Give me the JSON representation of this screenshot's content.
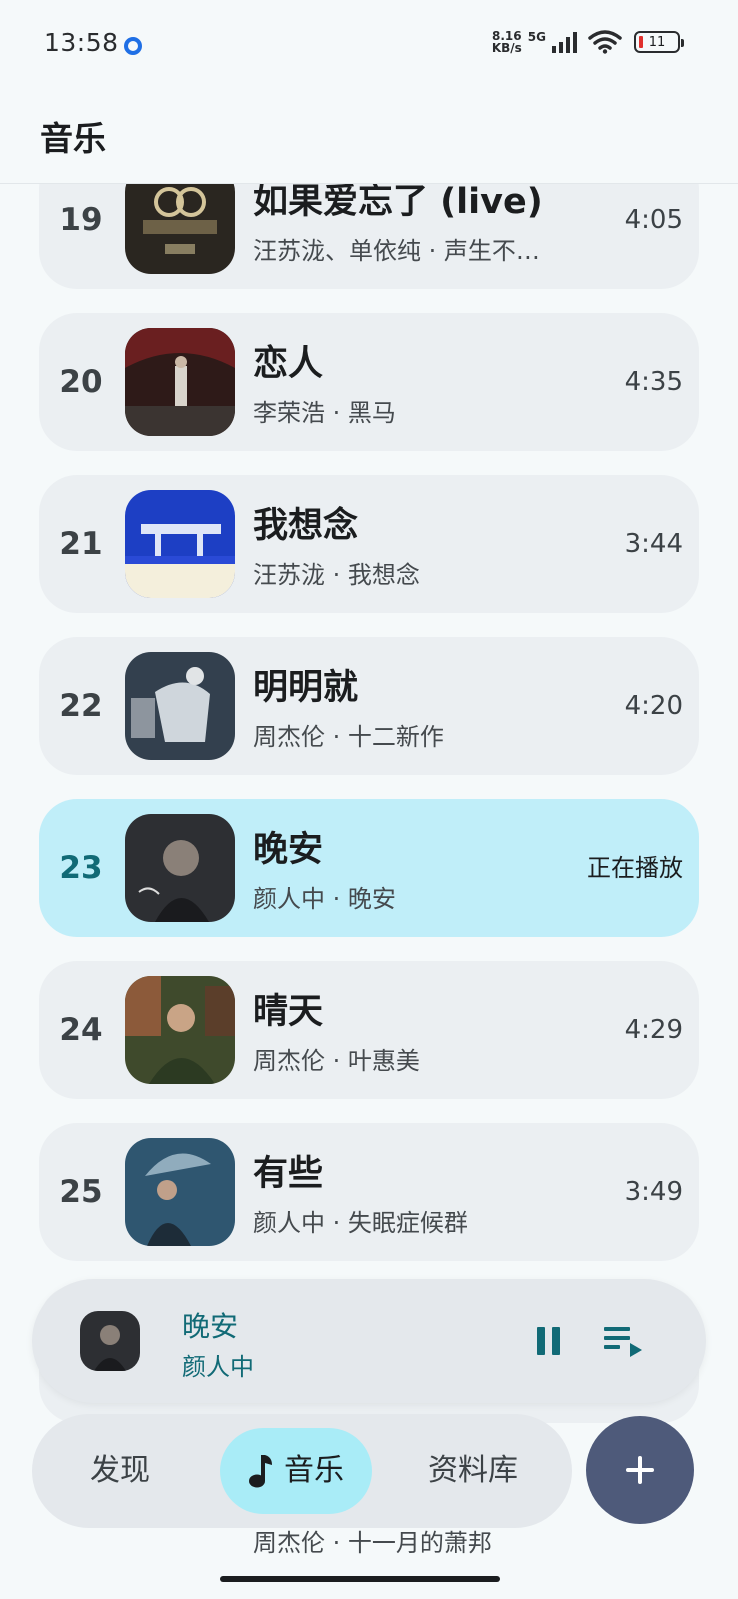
{
  "status_bar": {
    "time": "13:58",
    "net_speed_top": "8.16",
    "net_speed_bottom": "KB/s",
    "network": "5G",
    "battery": "11"
  },
  "header": {
    "title": "音乐"
  },
  "songs": [
    {
      "index": "19",
      "title": "如果爱忘了 (live)",
      "subtitle": "汪苏泷、单依纯 · 声生不…",
      "duration": "4:05"
    },
    {
      "index": "20",
      "title": "恋人",
      "subtitle": "李荣浩 · 黑马",
      "duration": "4:35"
    },
    {
      "index": "21",
      "title": "我想念",
      "subtitle": "汪苏泷 · 我想念",
      "duration": "3:44"
    },
    {
      "index": "22",
      "title": "明明就",
      "subtitle": "周杰伦 · 十二新作",
      "duration": "4:20"
    },
    {
      "index": "23",
      "title": "晚安",
      "subtitle": "颜人中 · 晚安",
      "duration": "正在播放"
    },
    {
      "index": "24",
      "title": "晴天",
      "subtitle": "周杰伦 · 叶惠美",
      "duration": "4:29"
    },
    {
      "index": "25",
      "title": "有些",
      "subtitle": "颜人中 · 失眠症候群",
      "duration": "3:49"
    }
  ],
  "partial_row": {
    "subtitle": "周杰伦 · 十一月的萧邦"
  },
  "mini_player": {
    "title": "晚安",
    "artist": "颜人中"
  },
  "bottom_nav": {
    "discover": "发现",
    "music": "音乐",
    "library": "资料库"
  },
  "icons": {
    "status_dot": "location-dot-icon",
    "signal": "signal-icon",
    "wifi": "wifi-icon",
    "battery": "battery-icon",
    "pause": "pause-icon",
    "queue": "queue-icon",
    "music_note": "music-note-icon",
    "add": "add-icon"
  },
  "colors": {
    "accent": "#116a76",
    "playing_row": "#c0eef9",
    "nav_active": "#a9ecf7",
    "fab": "#4e5a7a"
  }
}
